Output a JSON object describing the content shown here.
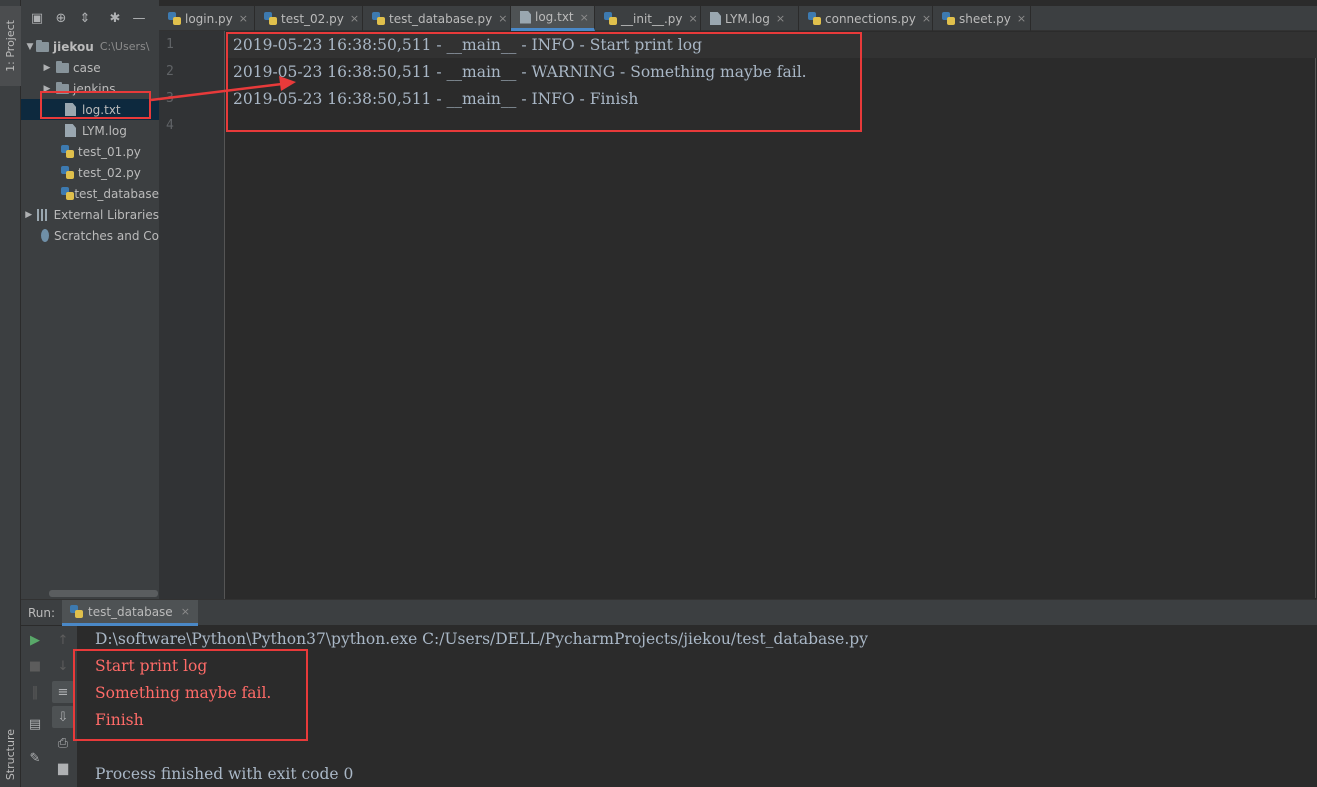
{
  "side_tabs": {
    "project": "1: Project",
    "structure": "Structure"
  },
  "project": {
    "root": {
      "name": "jiekou",
      "path": "C:\\Users\\"
    },
    "items": [
      {
        "label": "case"
      },
      {
        "label": "jenkins"
      },
      {
        "label": "log.txt"
      },
      {
        "label": "LYM.log"
      },
      {
        "label": "test_01.py"
      },
      {
        "label": "test_02.py"
      },
      {
        "label": "test_database"
      },
      {
        "label": "External Libraries"
      },
      {
        "label": "Scratches and Co"
      }
    ]
  },
  "tabs": [
    {
      "label": "login.py"
    },
    {
      "label": "test_02.py"
    },
    {
      "label": "test_database.py"
    },
    {
      "label": "log.txt"
    },
    {
      "label": "__init__.py"
    },
    {
      "label": "LYM.log"
    },
    {
      "label": "connections.py"
    },
    {
      "label": "sheet.py"
    }
  ],
  "close_glyph": "×",
  "editor": {
    "line_numbers": [
      "1",
      "2",
      "3",
      "4"
    ],
    "lines": [
      "2019-05-23 16:38:50,511 - __main__ - INFO - Start print log",
      "2019-05-23 16:38:50,511 - __main__ - WARNING - Something maybe fail.",
      "2019-05-23 16:38:50,511 - __main__ - INFO - Finish",
      ""
    ]
  },
  "run": {
    "label": "Run:",
    "tab": "test_database",
    "command": "D:\\software\\Python\\Python37\\python.exe C:/Users/DELL/PycharmProjects/jiekou/test_database.py",
    "stderr": [
      "Start print log",
      "Something maybe fail.",
      "Finish"
    ],
    "exit": "Process finished with exit code 0"
  },
  "colors": {
    "annotation_red": "#e83a3a",
    "stderr_red": "#ff6b68",
    "accent": "#4a88c7",
    "run_green": "#59a869"
  }
}
